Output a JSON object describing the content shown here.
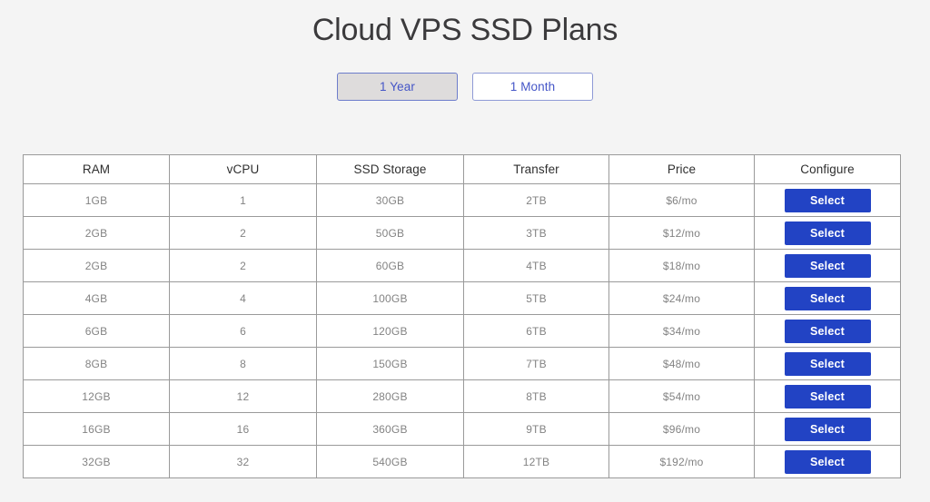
{
  "page": {
    "title": "Cloud VPS SSD Plans",
    "background_color": "#f4f4f4"
  },
  "billing_toggle": {
    "selected": "1 Year",
    "options": [
      {
        "label": "1 Year",
        "active": true
      },
      {
        "label": "1 Month",
        "active": false
      }
    ],
    "active_bg_color": "#dedcdc",
    "border_color": "#8e9ad6",
    "text_color": "#4455c7"
  },
  "plans_table": {
    "columns": [
      "RAM",
      "vCPU",
      "SSD Storage",
      "Transfer",
      "Price",
      "Configure"
    ],
    "action_label": "Select",
    "action_color": "#2243c4",
    "border_color": "#9a9a9a",
    "rows": [
      {
        "ram": "1GB",
        "vcpu": "1",
        "ssd": "30GB",
        "transfer": "2TB",
        "price": "$6/mo",
        "action": "Select"
      },
      {
        "ram": "2GB",
        "vcpu": "2",
        "ssd": "50GB",
        "transfer": "3TB",
        "price": "$12/mo",
        "action": "Select"
      },
      {
        "ram": "2GB",
        "vcpu": "2",
        "ssd": "60GB",
        "transfer": "4TB",
        "price": "$18/mo",
        "action": "Select"
      },
      {
        "ram": "4GB",
        "vcpu": "4",
        "ssd": "100GB",
        "transfer": "5TB",
        "price": "$24/mo",
        "action": "Select"
      },
      {
        "ram": "6GB",
        "vcpu": "6",
        "ssd": "120GB",
        "transfer": "6TB",
        "price": "$34/mo",
        "action": "Select"
      },
      {
        "ram": "8GB",
        "vcpu": "8",
        "ssd": "150GB",
        "transfer": "7TB",
        "price": "$48/mo",
        "action": "Select"
      },
      {
        "ram": "12GB",
        "vcpu": "12",
        "ssd": "280GB",
        "transfer": "8TB",
        "price": "$54/mo",
        "action": "Select"
      },
      {
        "ram": "16GB",
        "vcpu": "16",
        "ssd": "360GB",
        "transfer": "9TB",
        "price": "$96/mo",
        "action": "Select"
      },
      {
        "ram": "32GB",
        "vcpu": "32",
        "ssd": "540GB",
        "transfer": "12TB",
        "price": "$192/mo",
        "action": "Select"
      }
    ]
  }
}
